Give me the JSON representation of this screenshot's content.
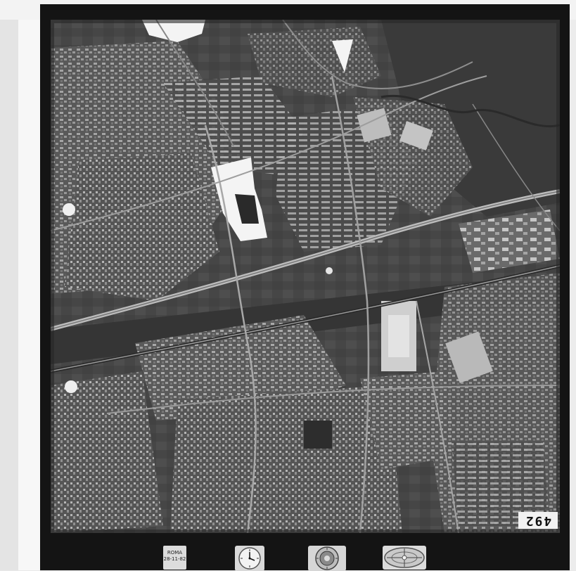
{
  "image": {
    "kind": "aerial-photograph-film-scan",
    "frame_number": "492",
    "data_plate_lines": [
      "ROMA",
      "28-11-82"
    ],
    "instrument_icons": [
      "data-plate-icon",
      "clock-icon",
      "altimeter-icon",
      "level-bubble-icon"
    ],
    "colors": {
      "film_border": "#141414",
      "scanner_background": "#ececec",
      "photo_base": "#3f3f3f",
      "built_up": "#8a8a8a",
      "highway": "#bdbdbd",
      "bright_patch": "#f4f4f4"
    }
  }
}
